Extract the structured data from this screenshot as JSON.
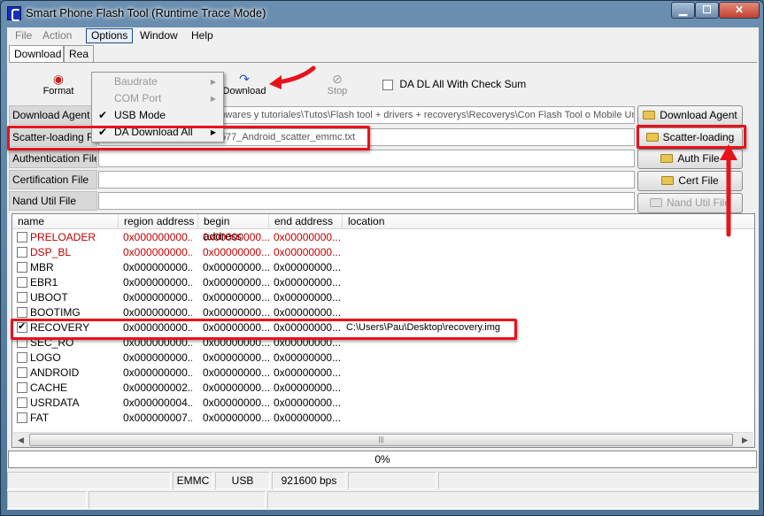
{
  "window": {
    "title": "Smart Phone Flash Tool (Runtime Trace Mode)"
  },
  "menu": {
    "items": [
      "File",
      "Action",
      "Options",
      "Window",
      "Help"
    ],
    "options_dropdown": [
      {
        "label": "Baudrate",
        "enabled": false,
        "checked": false,
        "submenu": true
      },
      {
        "label": "COM Port",
        "enabled": false,
        "checked": false,
        "submenu": true
      },
      {
        "label": "USB Mode",
        "enabled": true,
        "checked": true,
        "submenu": false
      },
      {
        "label": "DA Download All",
        "enabled": true,
        "checked": true,
        "submenu": true
      }
    ]
  },
  "tabs": [
    "Download",
    "Rea"
  ],
  "toolbar": {
    "format_label": "Format",
    "download_label": "Download",
    "stop_label": "Stop",
    "checksum_label": "DA DL All With Check Sum"
  },
  "form": {
    "download_agent": {
      "label": "Download Agent",
      "value": "C:\\Users\\Pau\\Escritorio\\Firmwares y tutoriales\\Tutos\\Flash tool + drivers + recoverys\\Recoverys\\Con Flash Tool o Mobile Uncle\\SP_Flash_Tool_exe"
    },
    "scatter": {
      "label": "Scatter-loading File",
      "value": "C:\\Users\\Pau\\Desktop\\MT6577_Android_scatter_emmc.txt"
    },
    "auth": {
      "label": "Authentication File",
      "value": ""
    },
    "cert": {
      "label": "Certification File",
      "value": ""
    },
    "nand": {
      "label": "Nand Util File",
      "value": ""
    }
  },
  "side_buttons": {
    "download_agent": "Download Agent",
    "scatter_loading": "Scatter-loading",
    "auth_file": "Auth File",
    "cert_file": "Cert File",
    "nand_util_file": "Nand Util File"
  },
  "table": {
    "headers": [
      "name",
      "region address",
      "begin address",
      "end address",
      "location"
    ],
    "rows": [
      {
        "name": "PRELOADER",
        "region": "0x000000000...",
        "begin": "0x00000000...",
        "end": "0x00000000...",
        "location": "",
        "checked": false,
        "red": true
      },
      {
        "name": "DSP_BL",
        "region": "0x000000000...",
        "begin": "0x00000000...",
        "end": "0x00000000...",
        "location": "",
        "checked": false,
        "red": true
      },
      {
        "name": "MBR",
        "region": "0x000000000...",
        "begin": "0x00000000...",
        "end": "0x00000000...",
        "location": "",
        "checked": false,
        "red": false
      },
      {
        "name": "EBR1",
        "region": "0x000000000...",
        "begin": "0x00000000...",
        "end": "0x00000000...",
        "location": "",
        "checked": false,
        "red": false
      },
      {
        "name": "UBOOT",
        "region": "0x000000000...",
        "begin": "0x00000000...",
        "end": "0x00000000...",
        "location": "",
        "checked": false,
        "red": false
      },
      {
        "name": "BOOTIMG",
        "region": "0x000000000...",
        "begin": "0x00000000...",
        "end": "0x00000000...",
        "location": "",
        "checked": false,
        "red": false
      },
      {
        "name": "RECOVERY",
        "region": "0x000000000...",
        "begin": "0x00000000...",
        "end": "0x00000000...",
        "location": "C:\\Users\\Pau\\Desktop\\recovery.img",
        "checked": true,
        "red": false
      },
      {
        "name": "SEC_RO",
        "region": "0x000000000...",
        "begin": "0x00000000...",
        "end": "0x00000000...",
        "location": "",
        "checked": false,
        "red": false
      },
      {
        "name": "LOGO",
        "region": "0x000000000...",
        "begin": "0x00000000...",
        "end": "0x00000000...",
        "location": "",
        "checked": false,
        "red": false
      },
      {
        "name": "ANDROID",
        "region": "0x000000000...",
        "begin": "0x00000000...",
        "end": "0x00000000...",
        "location": "",
        "checked": false,
        "red": false
      },
      {
        "name": "CACHE",
        "region": "0x000000002...",
        "begin": "0x00000000...",
        "end": "0x00000000...",
        "location": "",
        "checked": false,
        "red": false
      },
      {
        "name": "USRDATA",
        "region": "0x000000004...",
        "begin": "0x00000000...",
        "end": "0x00000000...",
        "location": "",
        "checked": false,
        "red": false
      },
      {
        "name": "FAT",
        "region": "0x000000007...",
        "begin": "0x00000000...",
        "end": "0x00000000...",
        "location": "",
        "checked": false,
        "red": false
      }
    ]
  },
  "progress": {
    "text": "0%",
    "fraction": 0
  },
  "status": {
    "storage": "EMMC",
    "connection": "USB",
    "baud": "921600 bps"
  },
  "colors": {
    "annotation_red": "#e8121b",
    "partition_red": "#c00000",
    "title_blue": "#5b82a8"
  }
}
